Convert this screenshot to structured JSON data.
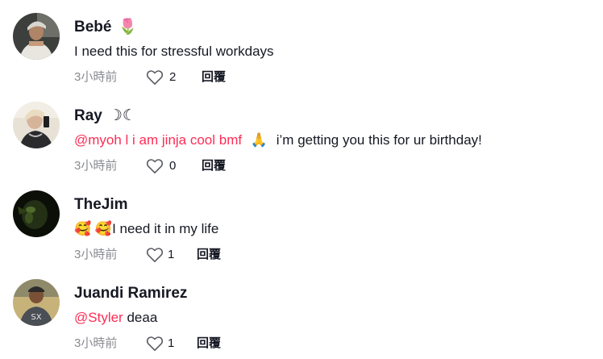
{
  "comments": [
    {
      "username": "Bebé",
      "username_emoji": "🌷",
      "mention": "",
      "text": "I need this for stressful workdays",
      "time": "3小時前",
      "likes": "2",
      "reply_label": "回覆"
    },
    {
      "username": "Ray",
      "username_emoji": "☽☾",
      "mention": "@myoh  l  i  am  jinja  cool  bmf",
      "mention_emoji": "🙏",
      "text": "i’m getting you this for ur birthday!",
      "time": "3小時前",
      "likes": "0",
      "reply_label": "回覆"
    },
    {
      "username": "TheJim",
      "username_emoji": "",
      "mention": "",
      "text_emoji": "🥰 🥰",
      "text": "I need it in my life",
      "time": "3小時前",
      "likes": "1",
      "reply_label": "回覆"
    },
    {
      "username": "Juandi Ramirez",
      "username_emoji": "",
      "mention": "@Styler",
      "text": "deaa",
      "time": "3小時前",
      "likes": "1",
      "reply_label": "回覆"
    }
  ],
  "icons": {
    "like": "heart-outline-icon"
  },
  "colors": {
    "mention": "#fe2c55",
    "meta": "#8a8b91",
    "text": "#161823"
  }
}
